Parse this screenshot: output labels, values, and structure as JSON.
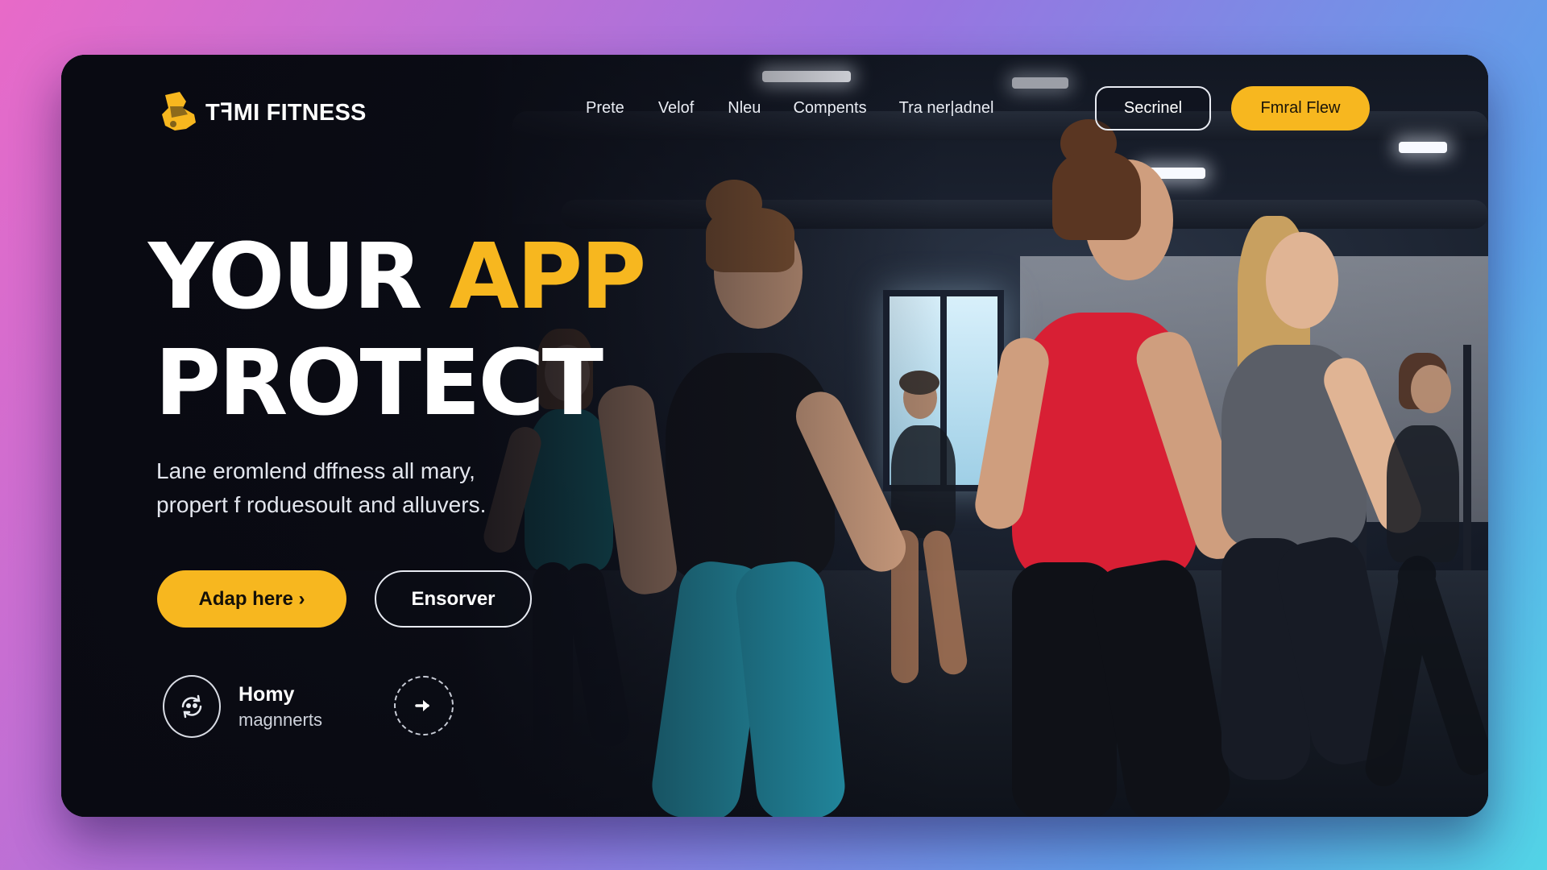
{
  "brand": {
    "name": "TꟻMI FITNESS",
    "logo_icon": "shoe-icon",
    "accent": "#f7b71f"
  },
  "nav": {
    "items": [
      {
        "label": "Prete"
      },
      {
        "label": "Velof"
      },
      {
        "label": "Nleu"
      },
      {
        "label": "Compents"
      },
      {
        "label": "Tra ner|adnel"
      }
    ],
    "secondary_button": "Secrinel",
    "primary_button": "Fmral Flew"
  },
  "hero": {
    "title_white": "YOUR ",
    "title_accent": "APP",
    "title_line2": "PROTECT",
    "subtitle_line1": "Lane eromlend dffness all mary,",
    "subtitle_line2": "propert f roduesoult and alluvers.",
    "primary_cta": "Adap here ›",
    "secondary_cta": "Ensorver"
  },
  "feature": {
    "icon": "refresh-people-icon",
    "title": "Homy",
    "subtitle": "magnnerts",
    "arrow_icon": "arrow-right-icon"
  },
  "colors": {
    "background_gradient": [
      "#e86ac8",
      "#9a74e0",
      "#5fa0ea",
      "#52d4e6"
    ],
    "panel": "#0b0d16",
    "accent": "#f7b71f"
  }
}
